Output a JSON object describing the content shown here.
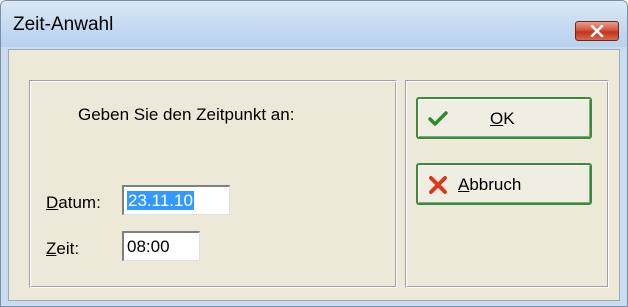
{
  "window": {
    "title": "Zeit-Anwahl",
    "close_label": "Close"
  },
  "form": {
    "instruction": "Geben Sie den Zeitpunkt an:",
    "date_label_accel": "D",
    "date_label_rest": "atum:",
    "date_value": "23.11.10",
    "time_label_accel": "Z",
    "time_label_rest": "eit:",
    "time_value": "08:00"
  },
  "buttons": {
    "ok_accel": "O",
    "ok_rest": "K",
    "cancel_accel": "A",
    "cancel_rest": "bbruch"
  },
  "icons": {
    "close": "close-x-icon",
    "ok": "checkmark-icon",
    "cancel": "red-x-icon"
  },
  "colors": {
    "accent_green": "#2e8b2e",
    "cancel_red": "#d83a1a",
    "selection": "#3399ff"
  }
}
